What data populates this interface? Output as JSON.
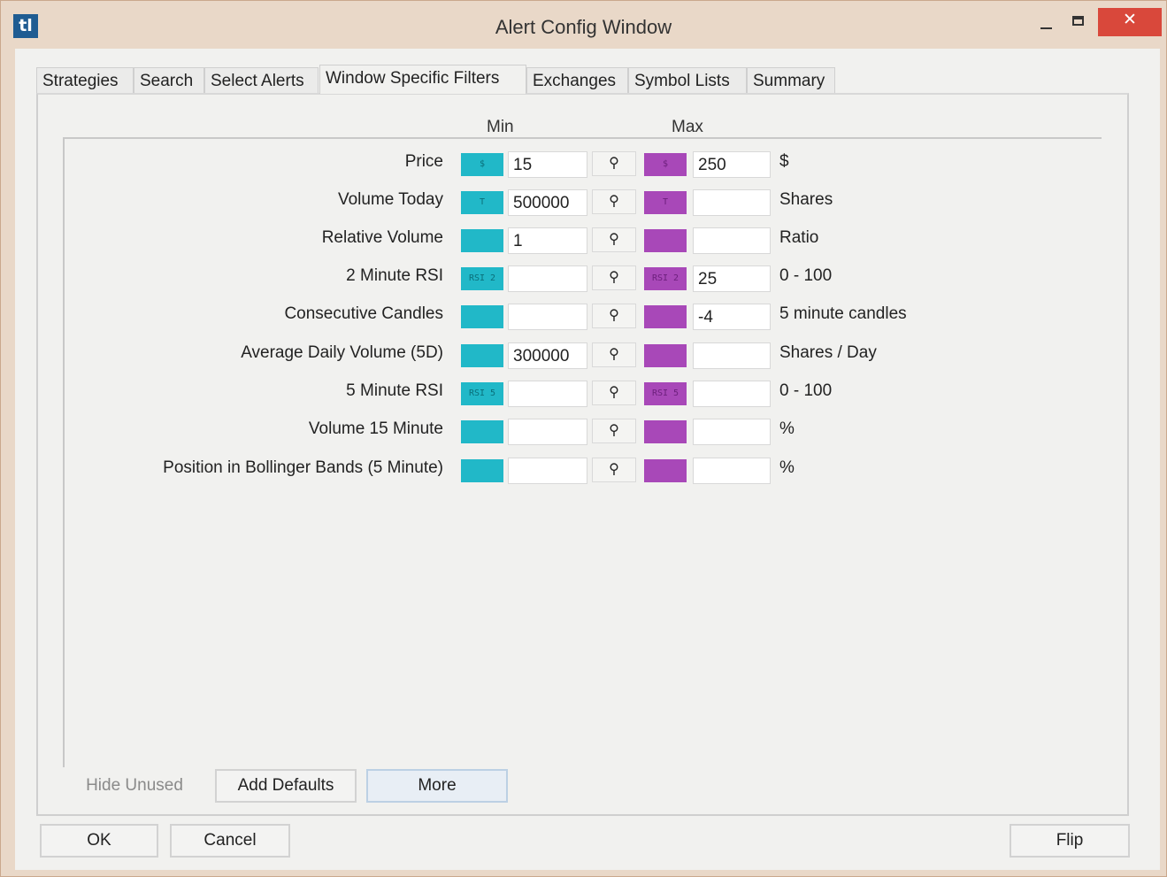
{
  "window": {
    "title": "Alert Config Window",
    "app_icon": "tl",
    "close_glyph": "✕"
  },
  "tabs": [
    {
      "label": "Strategies",
      "active": false
    },
    {
      "label": "Search",
      "active": false
    },
    {
      "label": "Select Alerts",
      "active": false
    },
    {
      "label": "Window Specific Filters",
      "active": true
    },
    {
      "label": "Exchanges",
      "active": false
    },
    {
      "label": "Symbol Lists",
      "active": false
    },
    {
      "label": "Summary",
      "active": false
    }
  ],
  "columns": {
    "min": "Min",
    "max": "Max"
  },
  "filters": [
    {
      "label": "Price",
      "min_icon": "$",
      "max_icon": "$",
      "min": "15",
      "max": "250",
      "unit": "$"
    },
    {
      "label": "Volume Today",
      "min_icon": "T",
      "max_icon": "T",
      "min": "500000",
      "max": "",
      "unit": "Shares"
    },
    {
      "label": "Relative Volume",
      "min_icon": "",
      "max_icon": "",
      "min": "1",
      "max": "",
      "unit": "Ratio"
    },
    {
      "label": "2 Minute RSI",
      "min_icon": "RSI 2",
      "max_icon": "RSI 2",
      "min": "",
      "max": "25",
      "unit": "0 - 100"
    },
    {
      "label": "Consecutive Candles",
      "min_icon": "",
      "max_icon": "",
      "min": "",
      "max": "-4",
      "unit": "5 minute candles"
    },
    {
      "label": "Average Daily Volume (5D)",
      "min_icon": "",
      "max_icon": "",
      "min": "300000",
      "max": "",
      "unit": "Shares / Day"
    },
    {
      "label": "5 Minute RSI",
      "min_icon": "RSI 5",
      "max_icon": "RSI 5",
      "min": "",
      "max": "",
      "unit": "0 - 100"
    },
    {
      "label": "Volume 15 Minute",
      "min_icon": "",
      "max_icon": "",
      "min": "",
      "max": "",
      "unit": "%"
    },
    {
      "label": "Position in Bollinger Bands (5 Minute)",
      "min_icon": "",
      "max_icon": "",
      "min": "",
      "max": "",
      "unit": "%"
    }
  ],
  "picker_glyph": "⚲",
  "buttons": {
    "hide_unused": "Hide Unused",
    "add_defaults": "Add Defaults",
    "more": "More",
    "ok": "OK",
    "cancel": "Cancel",
    "flip": "Flip"
  },
  "colors": {
    "min_accent": "#21b8c8",
    "max_accent": "#a848b8",
    "close_button": "#d9483b"
  }
}
